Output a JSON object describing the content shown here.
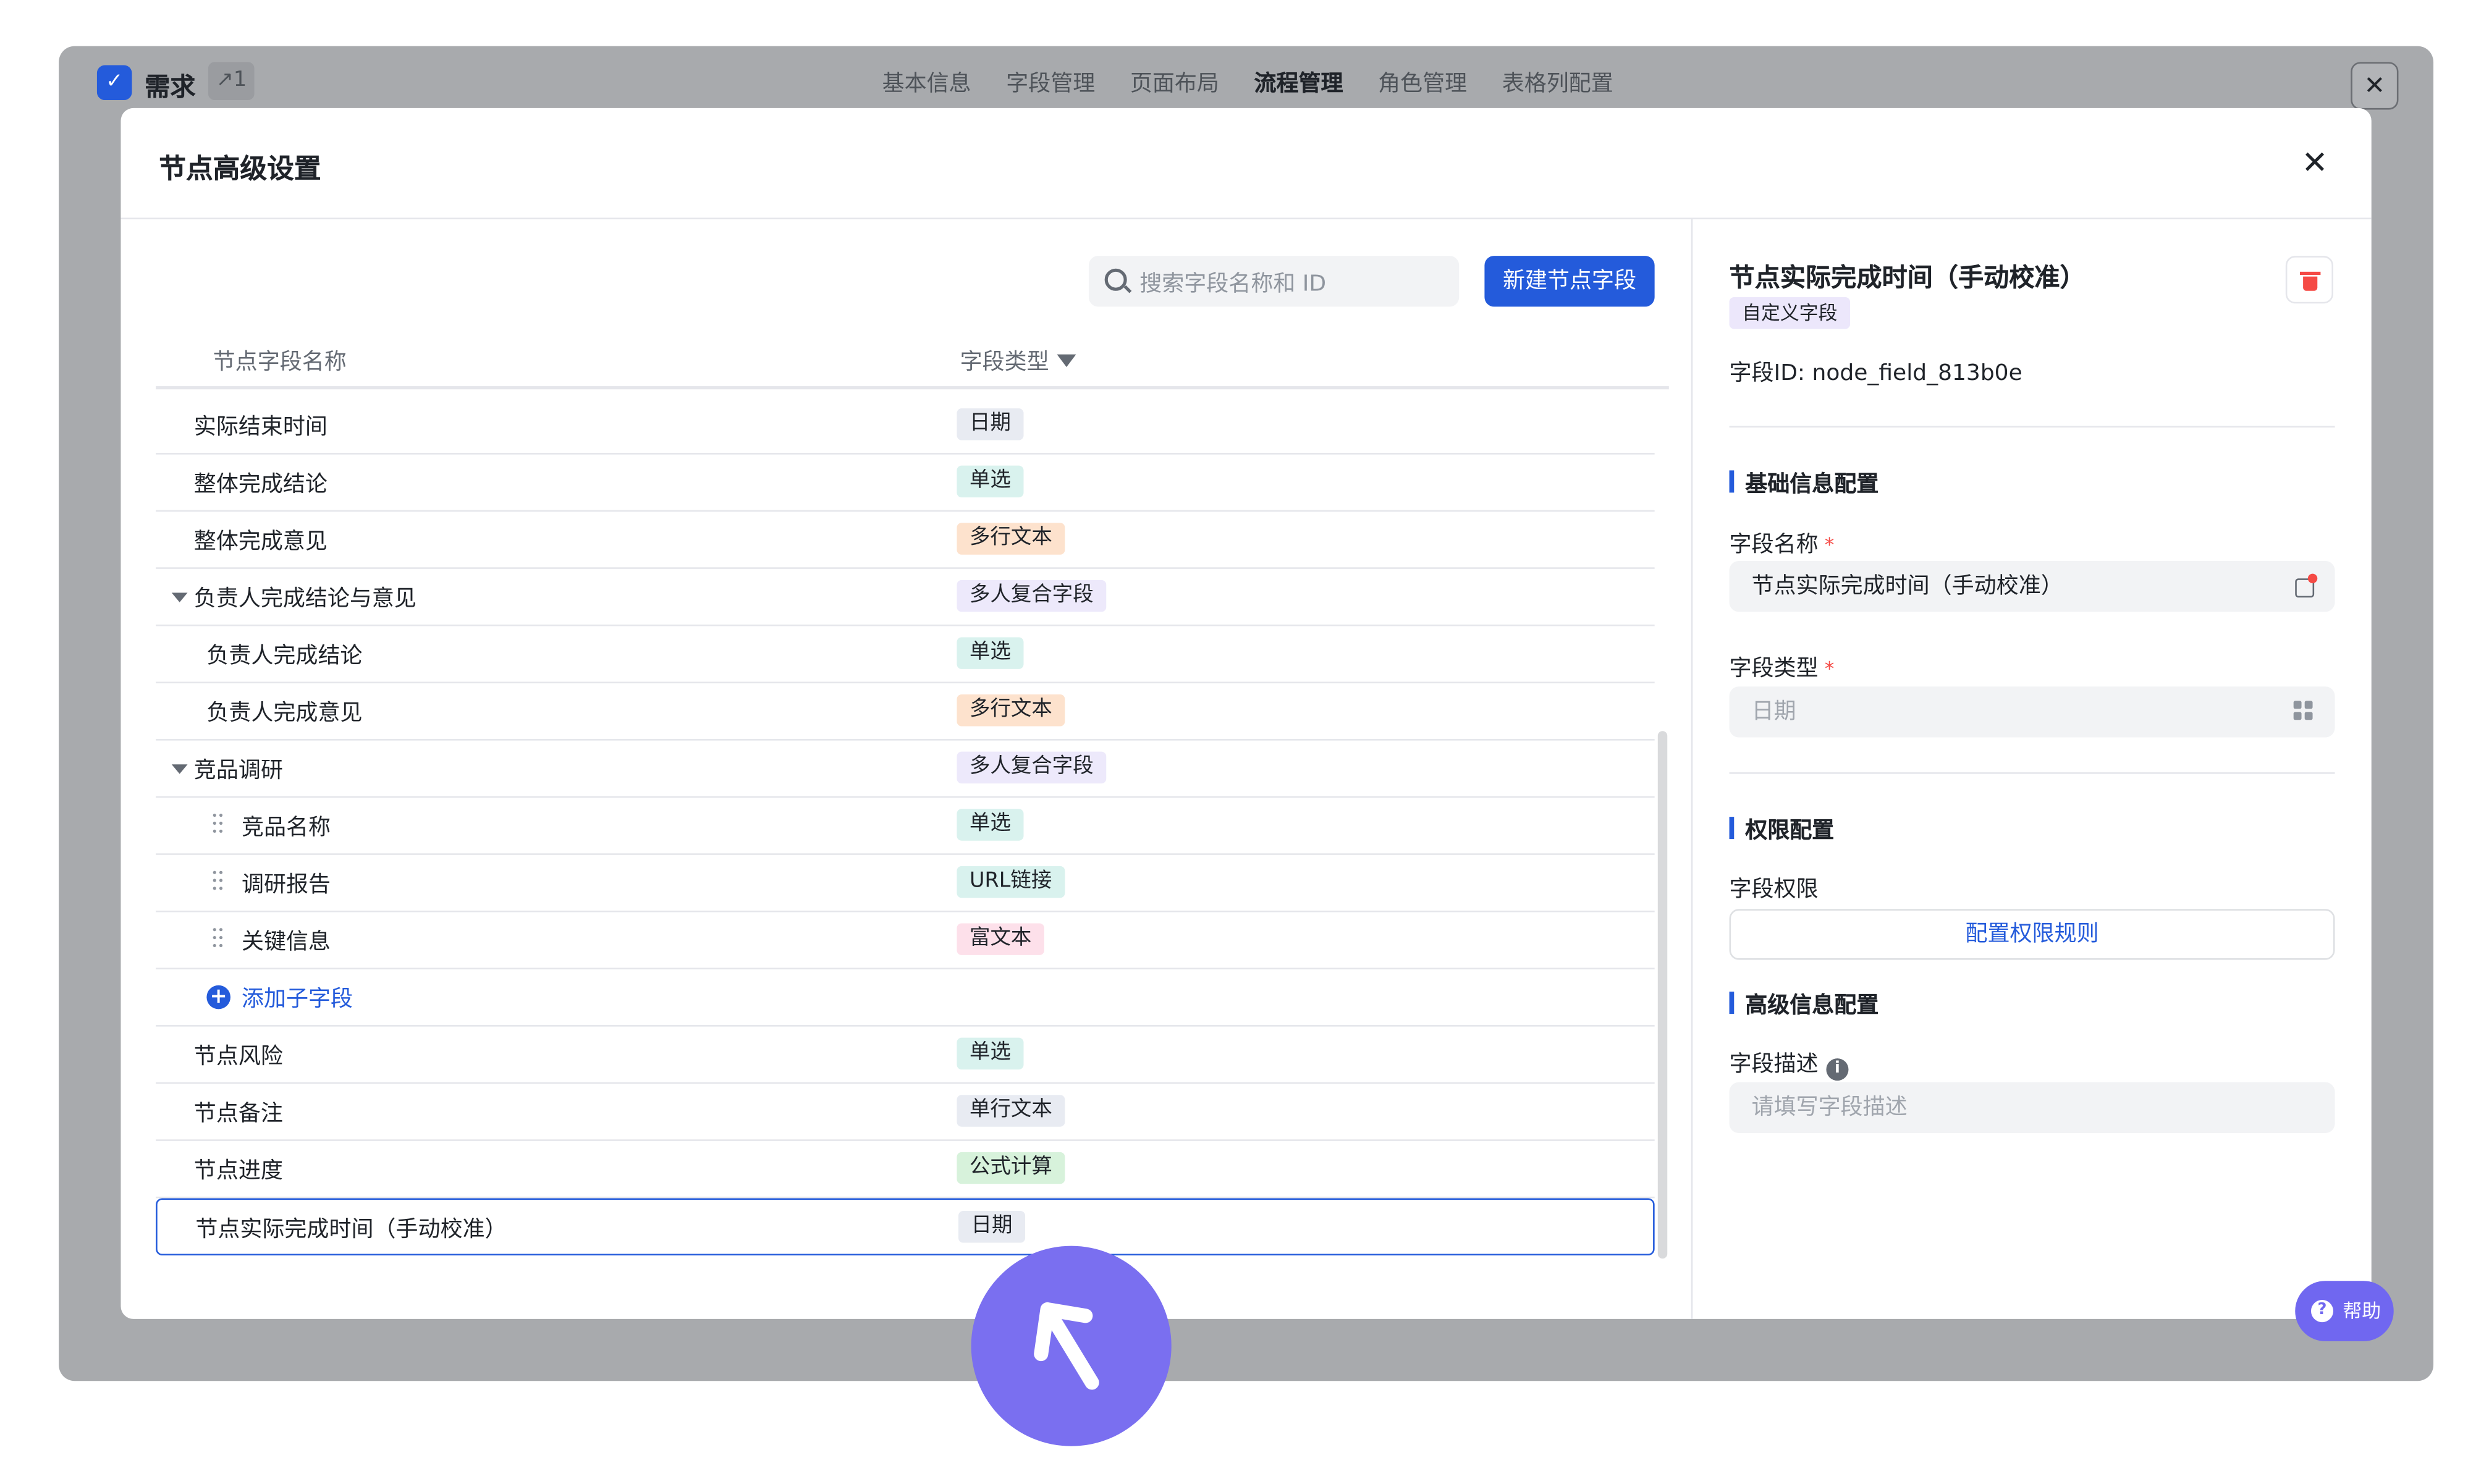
{
  "app": {
    "logo_glyph": "✓",
    "title": "需求",
    "count": "↗1",
    "tabs": [
      {
        "label": "基本信息"
      },
      {
        "label": "字段管理"
      },
      {
        "label": "页面布局"
      },
      {
        "label": "流程管理"
      },
      {
        "label": "角色管理"
      },
      {
        "label": "表格列配置"
      }
    ],
    "active_tab": "流程管理",
    "close_glyph": "✕"
  },
  "modal": {
    "title": "节点高级设置",
    "close_glyph": "✕",
    "search_placeholder": "搜索字段名称和 ID",
    "new_button": "新建节点字段",
    "col_name": "节点字段名称",
    "col_type": "字段类型",
    "add_child_label": "添加子字段",
    "rows": [
      {
        "name": "实际结束时间",
        "type": "日期",
        "indent": 0
      },
      {
        "name": "整体完成结论",
        "type": "单选",
        "indent": 0
      },
      {
        "name": "整体完成意见",
        "type": "多行文本",
        "indent": 0
      },
      {
        "name": "负责人完成结论与意见",
        "type": "多人复合字段",
        "indent": 0,
        "group": true
      },
      {
        "name": "负责人完成结论",
        "type": "单选",
        "indent": 1
      },
      {
        "name": "负责人完成意见",
        "type": "多行文本",
        "indent": 1
      },
      {
        "name": "竞品调研",
        "type": "多人复合字段",
        "indent": 0,
        "group": true
      },
      {
        "name": "竞品名称",
        "type": "单选",
        "indent": 2
      },
      {
        "name": "调研报告",
        "type": "URL链接",
        "indent": 2
      },
      {
        "name": "关键信息",
        "type": "富文本",
        "indent": 2
      },
      {
        "name": "添加子字段",
        "type": "",
        "indent": 3
      },
      {
        "name": "节点风险",
        "type": "单选",
        "indent": 0
      },
      {
        "name": "节点备注",
        "type": "单行文本",
        "indent": 0
      },
      {
        "name": "节点进度",
        "type": "公式计算",
        "indent": 0
      },
      {
        "name": "节点实际完成时间（手动校准）",
        "type": "日期",
        "indent": 0,
        "selected": true
      }
    ]
  },
  "tag_colors": {
    "日期": {
      "bg": "#e8ebf2",
      "fg": "#1f2329"
    },
    "单选": {
      "bg": "#d9f2ee",
      "fg": "#1f2329"
    },
    "多行文本": {
      "bg": "#fde2cd",
      "fg": "#1f2329"
    },
    "多人复合字段": {
      "bg": "#ede9fb",
      "fg": "#1f2329"
    },
    "URL链接": {
      "bg": "#d9f2ee",
      "fg": "#1f2329"
    },
    "富文本": {
      "bg": "#fde0ea",
      "fg": "#1f2329"
    },
    "单行文本": {
      "bg": "#e8ebf2",
      "fg": "#1f2329"
    },
    "公式计算": {
      "bg": "#d7f2db",
      "fg": "#1f2329"
    }
  },
  "detail": {
    "title": "节点实际完成时间（手动校准）",
    "badge": "自定义字段",
    "field_id": "字段ID:  node_field_813b0e",
    "basic_section": "基础信息配置",
    "name_label": "字段名称",
    "name_value": "节点实际完成时间（手动校准）",
    "type_label": "字段类型",
    "type_value": "日期",
    "required_mark": "*",
    "perm_section": "权限配置",
    "perm_label": "字段权限",
    "perm_button": "配置权限规则",
    "adv_section": "高级信息配置",
    "desc_label": "字段描述",
    "desc_placeholder": "请填写字段描述",
    "info_glyph": "i"
  },
  "help": {
    "glyph": "?",
    "label": "帮助"
  },
  "colors": {
    "accent": "#245bdb",
    "danger": "#f54a45",
    "cursor": "#7a6ff0"
  }
}
